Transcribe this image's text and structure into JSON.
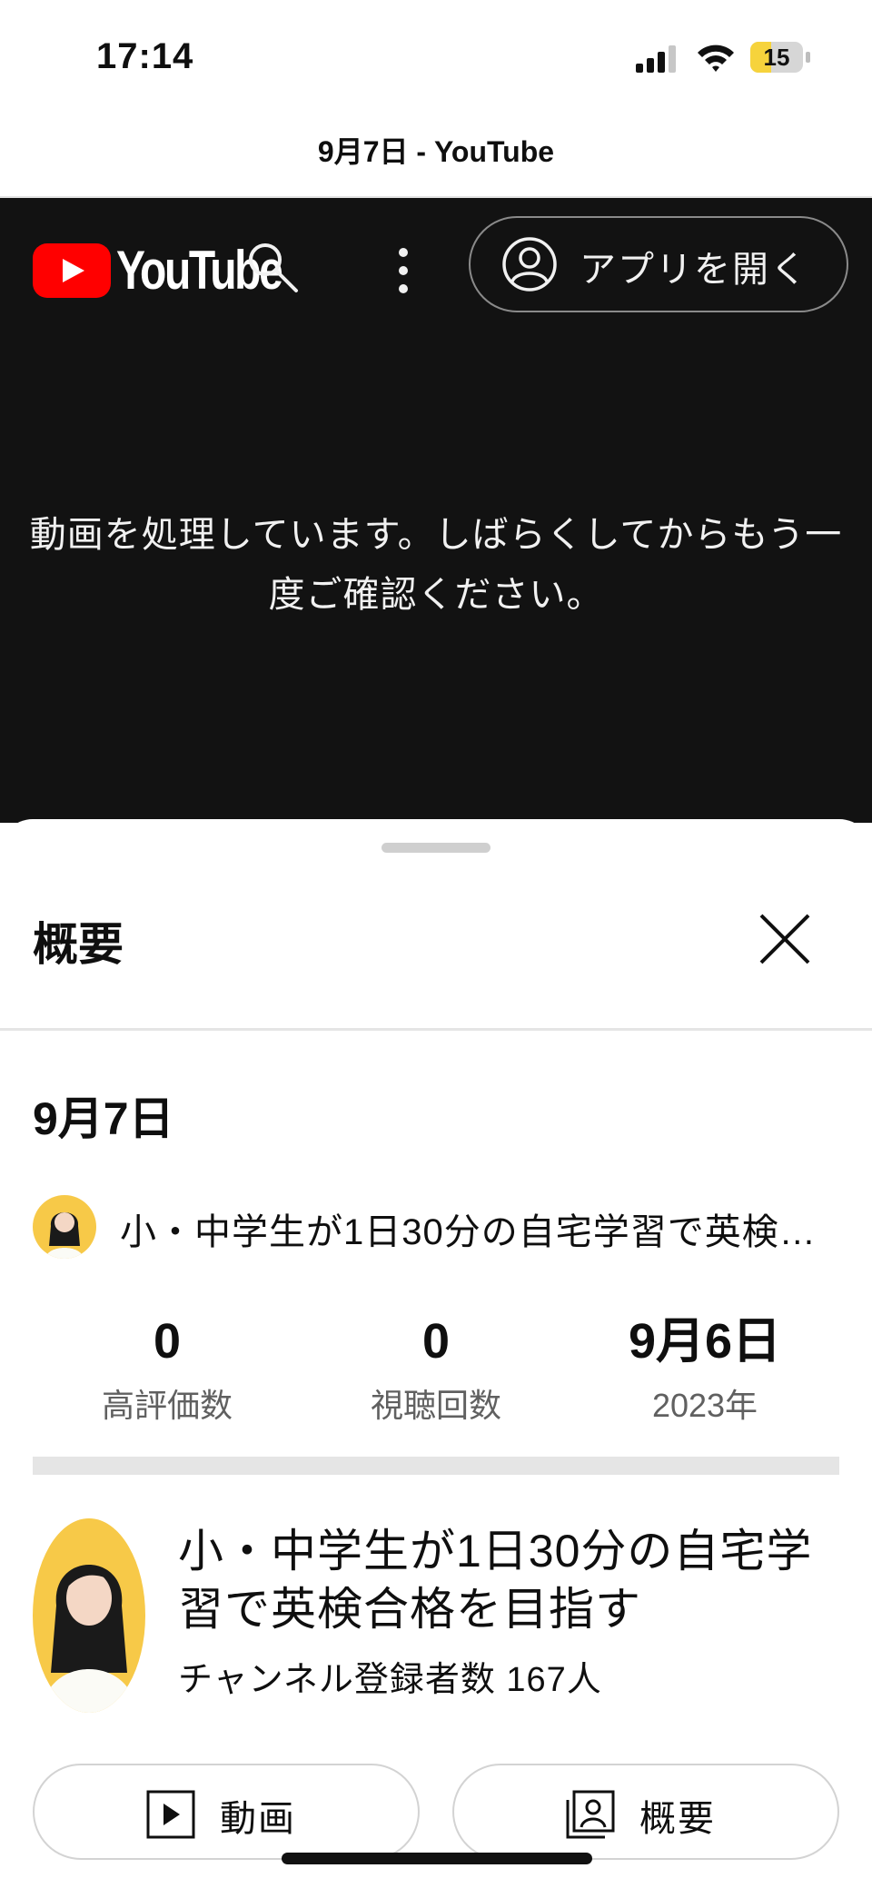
{
  "status_bar": {
    "time": "17:14",
    "battery_level": "15",
    "battery_fraction": 0.15
  },
  "browser": {
    "page_title": "9月7日 - YouTube"
  },
  "header": {
    "logo_text": "YouTube",
    "open_app_label": "アプリを開く"
  },
  "player": {
    "message": "動画を処理しています。しばらくしてからもう一度ご確認ください。"
  },
  "description_panel": {
    "heading": "概要",
    "video_title": "9月7日",
    "channel_line": "小・中学生が1日30分の自宅学習で英検合格を目指す",
    "stats": [
      {
        "value": "0",
        "label": "高評価数"
      },
      {
        "value": "0",
        "label": "視聴回数"
      },
      {
        "value": "9月6日",
        "label": "2023年"
      }
    ],
    "channel_name": "小・中学生が1日30分の自宅学習で英検合格を目指す",
    "subscribers": "チャンネル登録者数 167人",
    "buttons": {
      "videos": "動画",
      "about": "概要"
    }
  },
  "colors": {
    "brand_red": "#ff0000",
    "dark_bg": "#121212",
    "battery_yellow": "#f6d33c",
    "avatar_bg": "#f7c948"
  }
}
